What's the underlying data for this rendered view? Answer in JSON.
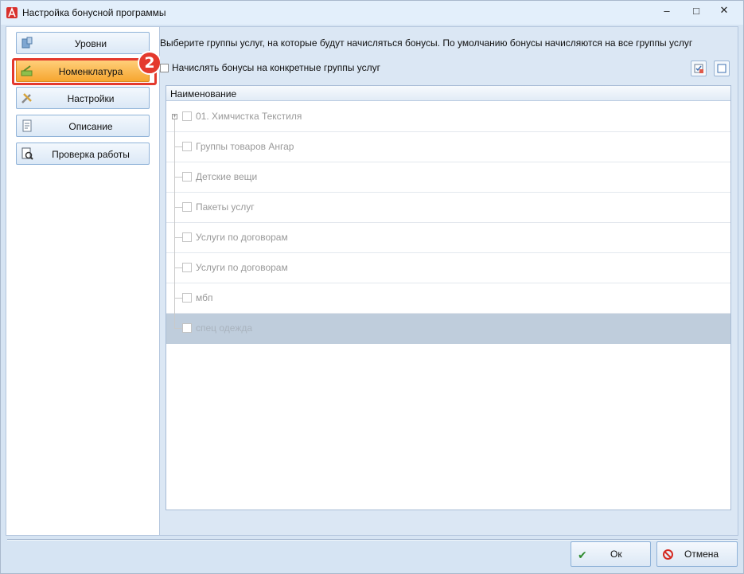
{
  "window": {
    "title": "Настройка бонусной программы",
    "minimize_glyph": "–",
    "maximize_glyph": "□",
    "close_glyph": "✕"
  },
  "sidebar": {
    "items": [
      {
        "label": "Уровни",
        "icon": "levels-icon"
      },
      {
        "label": "Номенклатура",
        "icon": "nomenclature-icon",
        "active": true
      },
      {
        "label": "Настройки",
        "icon": "settings-icon"
      },
      {
        "label": "Описание",
        "icon": "description-icon"
      },
      {
        "label": "Проверка работы",
        "icon": "check-work-icon"
      }
    ],
    "step_badge": "2"
  },
  "main": {
    "instruction": "Выберите группы услуг, на которые будут начисляться бонусы. По умолчанию бонусы начисляются на все группы услуг",
    "specific_groups_checkbox": {
      "label": "Начислять бонусы на конкретные группы услуг",
      "checked": false
    },
    "grid": {
      "column_header": "Наименование",
      "rows": [
        {
          "label": "01. Химчистка Текстиля",
          "expandable": true
        },
        {
          "label": "Группы товаров Ангар"
        },
        {
          "label": "Детские вещи"
        },
        {
          "label": "Пакеты услуг"
        },
        {
          "label": "Услуги по договорам"
        },
        {
          "label": "Услуги по договорам"
        },
        {
          "label": "мбп"
        },
        {
          "label": "спец одежда",
          "selected": true
        }
      ]
    }
  },
  "footer": {
    "ok_label": "Ок",
    "cancel_label": "Отмена"
  },
  "colors": {
    "accent_orange": "#f6a630",
    "highlight_red": "#e4392d",
    "panel_blue": "#dbe7f4"
  }
}
